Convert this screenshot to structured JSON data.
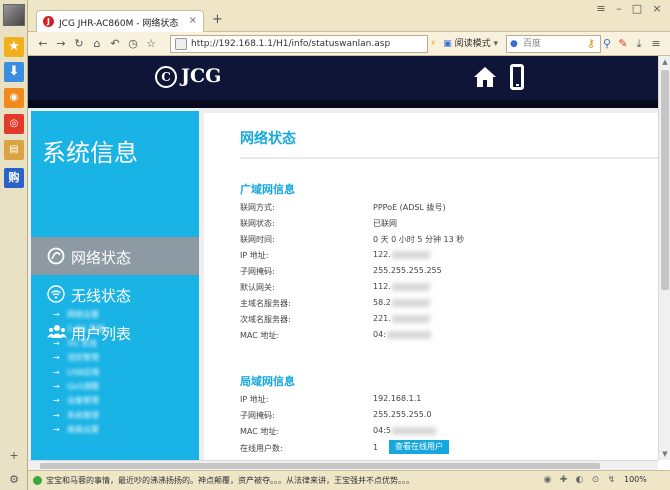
{
  "browser": {
    "tab_title": "JCG JHR-AC860M - 网络状态",
    "tab_favicon": "J",
    "address": "http://192.168.1.1/H1/info/statuswanlan.asp",
    "reader_mode": "阅读模式",
    "search_placeholder": "百度",
    "news_text": "宝宝和马蓉的事情，最近吵的沸沸扬扬的。神点颠覆，资产被夺。。。从法律来讲，王宝强并不点优势。。。",
    "zoom": "100%"
  },
  "header": {
    "logo_text": "JCG",
    "logo_mark": "C"
  },
  "sidebar": {
    "title": "系统信息",
    "nav": [
      {
        "label": "网络状态",
        "icon": "speedometer-icon",
        "active": true
      },
      {
        "label": "无线状态",
        "icon": "wifi-icon",
        "active": false
      },
      {
        "label": "用户列表",
        "icon": "users-icon",
        "active": false
      }
    ],
    "sub_items": [
      "网络设置",
      "2.4G 无线",
      "5G 无线",
      "流控管理",
      "USB应用",
      "QoS调整",
      "设备管理",
      "系统管理",
      "高级设置"
    ]
  },
  "content": {
    "title": "网络状态",
    "wan_title": "广域网信息",
    "wan": [
      {
        "label": "联网方式:",
        "value": "PPPoE (ADSL 拨号)",
        "masked": false
      },
      {
        "label": "联网状态:",
        "value": "已联网",
        "masked": false
      },
      {
        "label": "联网时间:",
        "value": "0 天 0 小时 5 分钟 13 秒",
        "masked": false
      },
      {
        "label": "IP 地址:",
        "value": "122.",
        "masked": true
      },
      {
        "label": "子网掩码:",
        "value": "255.255.255.255",
        "masked": false
      },
      {
        "label": "默认网关:",
        "value": "112.",
        "masked": true
      },
      {
        "label": "主域名服务器:",
        "value": "58.2",
        "masked": true
      },
      {
        "label": "次域名服务器:",
        "value": "221.",
        "masked": true
      },
      {
        "label": "MAC 地址:",
        "value": "04:",
        "masked": true
      }
    ],
    "lan_title": "局域网信息",
    "lan": [
      {
        "label": "IP 地址:",
        "value": "192.168.1.1",
        "masked": false
      },
      {
        "label": "子网掩码:",
        "value": "255.255.255.0",
        "masked": false
      },
      {
        "label": "MAC 地址:",
        "value": "04:5",
        "masked": true
      },
      {
        "label": "在线用户数:",
        "value": "1",
        "masked": false
      }
    ],
    "online_button": "查看在线用户"
  },
  "colors": {
    "accent": "#16a8dd",
    "sidebar": "#1ab3e6",
    "header": "#0f1536",
    "nav_active": "#8d9aa3"
  }
}
